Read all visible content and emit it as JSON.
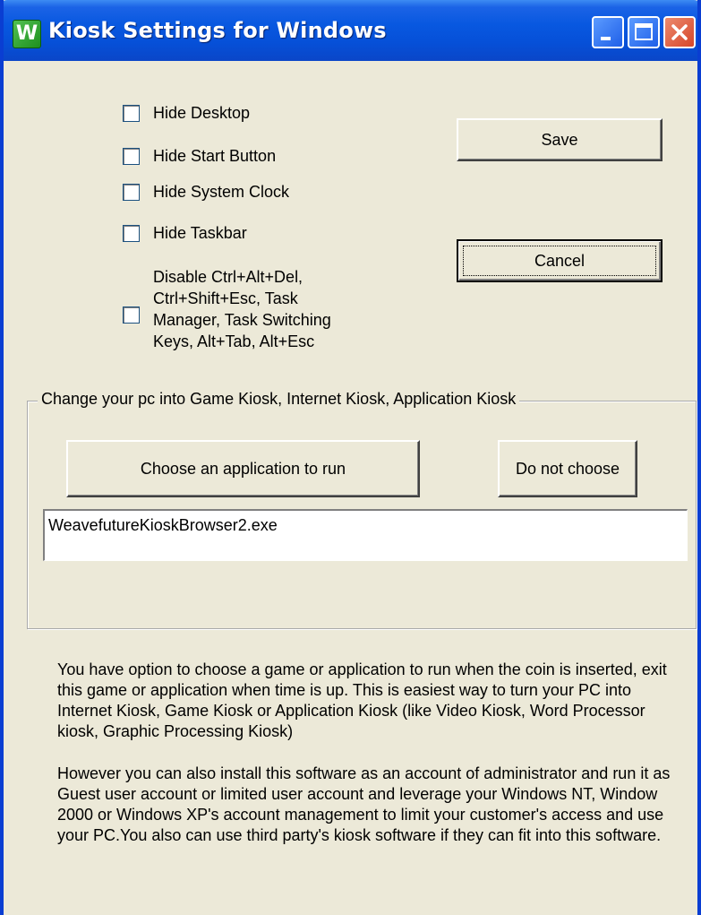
{
  "window": {
    "title": "Kiosk Settings for Windows",
    "icon_letter": "W",
    "accent_color": "#0a3ed2"
  },
  "titlebar_buttons": {
    "minimize": "minimize-icon",
    "maximize": "maximize-icon",
    "close": "close-icon"
  },
  "options": {
    "hide_desktop": {
      "label": "Hide Desktop",
      "checked": false
    },
    "hide_start_button": {
      "label": "Hide Start Button",
      "checked": false
    },
    "hide_system_clock": {
      "label": "Hide System Clock",
      "checked": false
    },
    "hide_taskbar": {
      "label": "Hide Taskbar",
      "checked": false
    },
    "disable_keys": {
      "line1": "Disable Ctrl+Alt+Del,",
      "line2": "Ctrl+Shift+Esc, Task",
      "line3": "Manager, Task Switching",
      "line4": "Keys, Alt+Tab, Alt+Esc",
      "checked": false
    }
  },
  "buttons": {
    "save": "Save",
    "cancel": "Cancel",
    "choose_app": "Choose an application to run",
    "do_not_choose": "Do not choose"
  },
  "kiosk_group": {
    "legend": "Change your pc into Game Kiosk, Internet Kiosk, Application Kiosk",
    "application_value": "WeavefutureKioskBrowser2.exe"
  },
  "info": {
    "paragraph1": "You have option to choose a game or application to run when the coin is inserted, exit this game or application when time is up. This is easiest way to turn your PC into Internet Kiosk, Game Kiosk or Application Kiosk (like Video Kiosk, Word Processor kiosk, Graphic Processing Kiosk)",
    "paragraph2": "However you can also install this software as an account of administrator and run it as Guest user account or limited user account and leverage your Windows NT, Window 2000 or Windows XP's account management to limit your customer's access and use your PC.You also can use third party's kiosk software if they can fit into this software."
  }
}
